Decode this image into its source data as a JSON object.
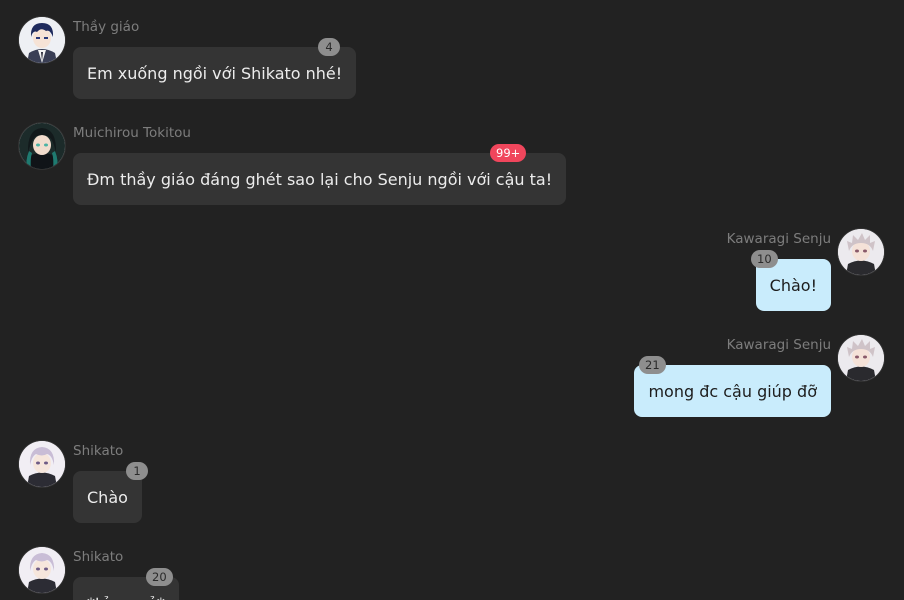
{
  "messages": [
    {
      "sender": "Thầy giáo",
      "text": "Em xuống ngồi với Shikato nhé!",
      "badge": "4",
      "side": "left"
    },
    {
      "sender": "Muichirou Tokitou",
      "text": "Đm thầy giáo đáng ghét sao lại cho Senju ngồi với cậu ta!",
      "badge": "99+",
      "side": "left"
    },
    {
      "sender": "Kawaragi Senju",
      "text": "Chào!",
      "badge": "10",
      "side": "right"
    },
    {
      "sender": "Kawaragi Senju",
      "text": "mong đc cậu giúp đỡ",
      "badge": "21",
      "side": "right"
    },
    {
      "sender": "Shikato",
      "text": "Chào",
      "badge": "1",
      "side": "left"
    },
    {
      "sender": "Shikato",
      "text": "*tỏ ra vẻ*",
      "badge": "20",
      "side": "left"
    }
  ],
  "colors": {
    "background": "#222222",
    "bubble_left": "#343434",
    "bubble_right": "#c9ecfc",
    "badge": "#8e8e8e",
    "badge_hot": "#f0465c"
  },
  "icons": {
    "teacher_avatar": "teacher-avatar-icon",
    "muichirou_avatar": "muichirou-avatar-icon",
    "senju_avatar": "senju-avatar-icon",
    "shikato_avatar": "shikato-avatar-icon"
  }
}
